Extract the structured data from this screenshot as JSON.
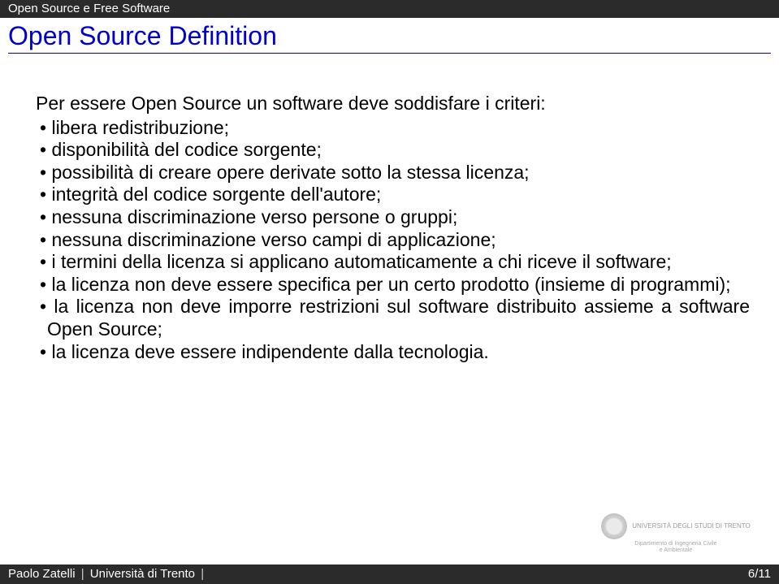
{
  "header": {
    "text": "Open Source e Free Software"
  },
  "title": "Open Source Definition",
  "intro": "Per essere Open Source un software deve soddisfare i criteri:",
  "bullets": [
    "libera redistribuzione;",
    "disponibilità del codice sorgente;",
    "possibilità di creare opere derivate sotto la stessa licenza;",
    "integrità del codice sorgente dell'autore;",
    "nessuna discriminazione verso persone o gruppi;",
    "nessuna discriminazione verso campi di applicazione;",
    "i termini della licenza si applicano automaticamente a chi riceve il software;",
    "la licenza non deve essere specifica per un certo prodotto (insieme di programmi);",
    "la licenza non deve imporre restrizioni sul software distribuito assieme a software Open Source;",
    "la licenza deve essere indipendente dalla tecnologia."
  ],
  "logo": {
    "line1": "UNIVERSITÀ DEGLI STUDI DI TRENTO",
    "line2": "Dipartimento di Ingegneria Civile",
    "line3": "e Ambientale"
  },
  "footer": {
    "author": "Paolo Zatelli",
    "affiliation": "Università di Trento",
    "page": "6/11"
  }
}
